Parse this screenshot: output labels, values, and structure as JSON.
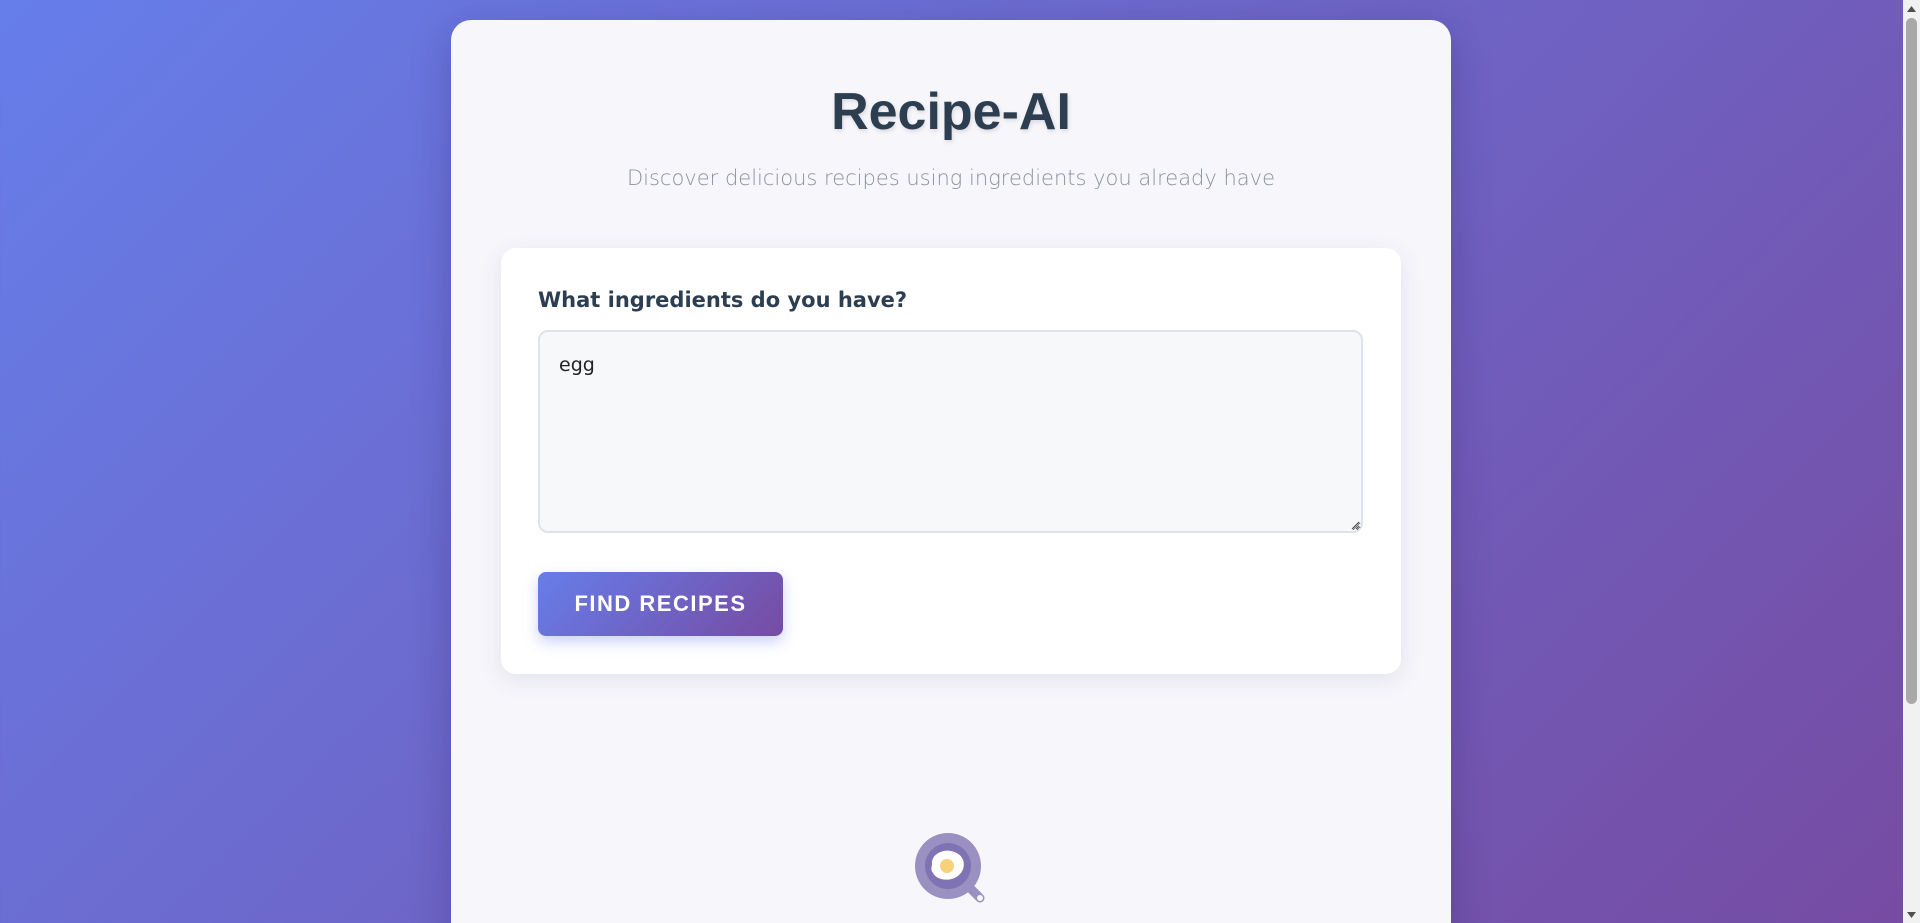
{
  "app": {
    "title": "Recipe-AI",
    "subtitle": "Discover delicious recipes using ingredients you already have"
  },
  "form": {
    "label": "What ingredients do you have?",
    "ingredients_value": "egg",
    "submit_label": "Find Recipes"
  },
  "icons": {
    "loading": "frying-pan-egg-icon",
    "scroll_up": "arrow-up-icon",
    "scroll_down": "arrow-down-icon"
  },
  "colors": {
    "gradient_start": "#667eea",
    "gradient_end": "#764ba2",
    "title": "#2c3e50",
    "subtitle": "#8c939b"
  }
}
